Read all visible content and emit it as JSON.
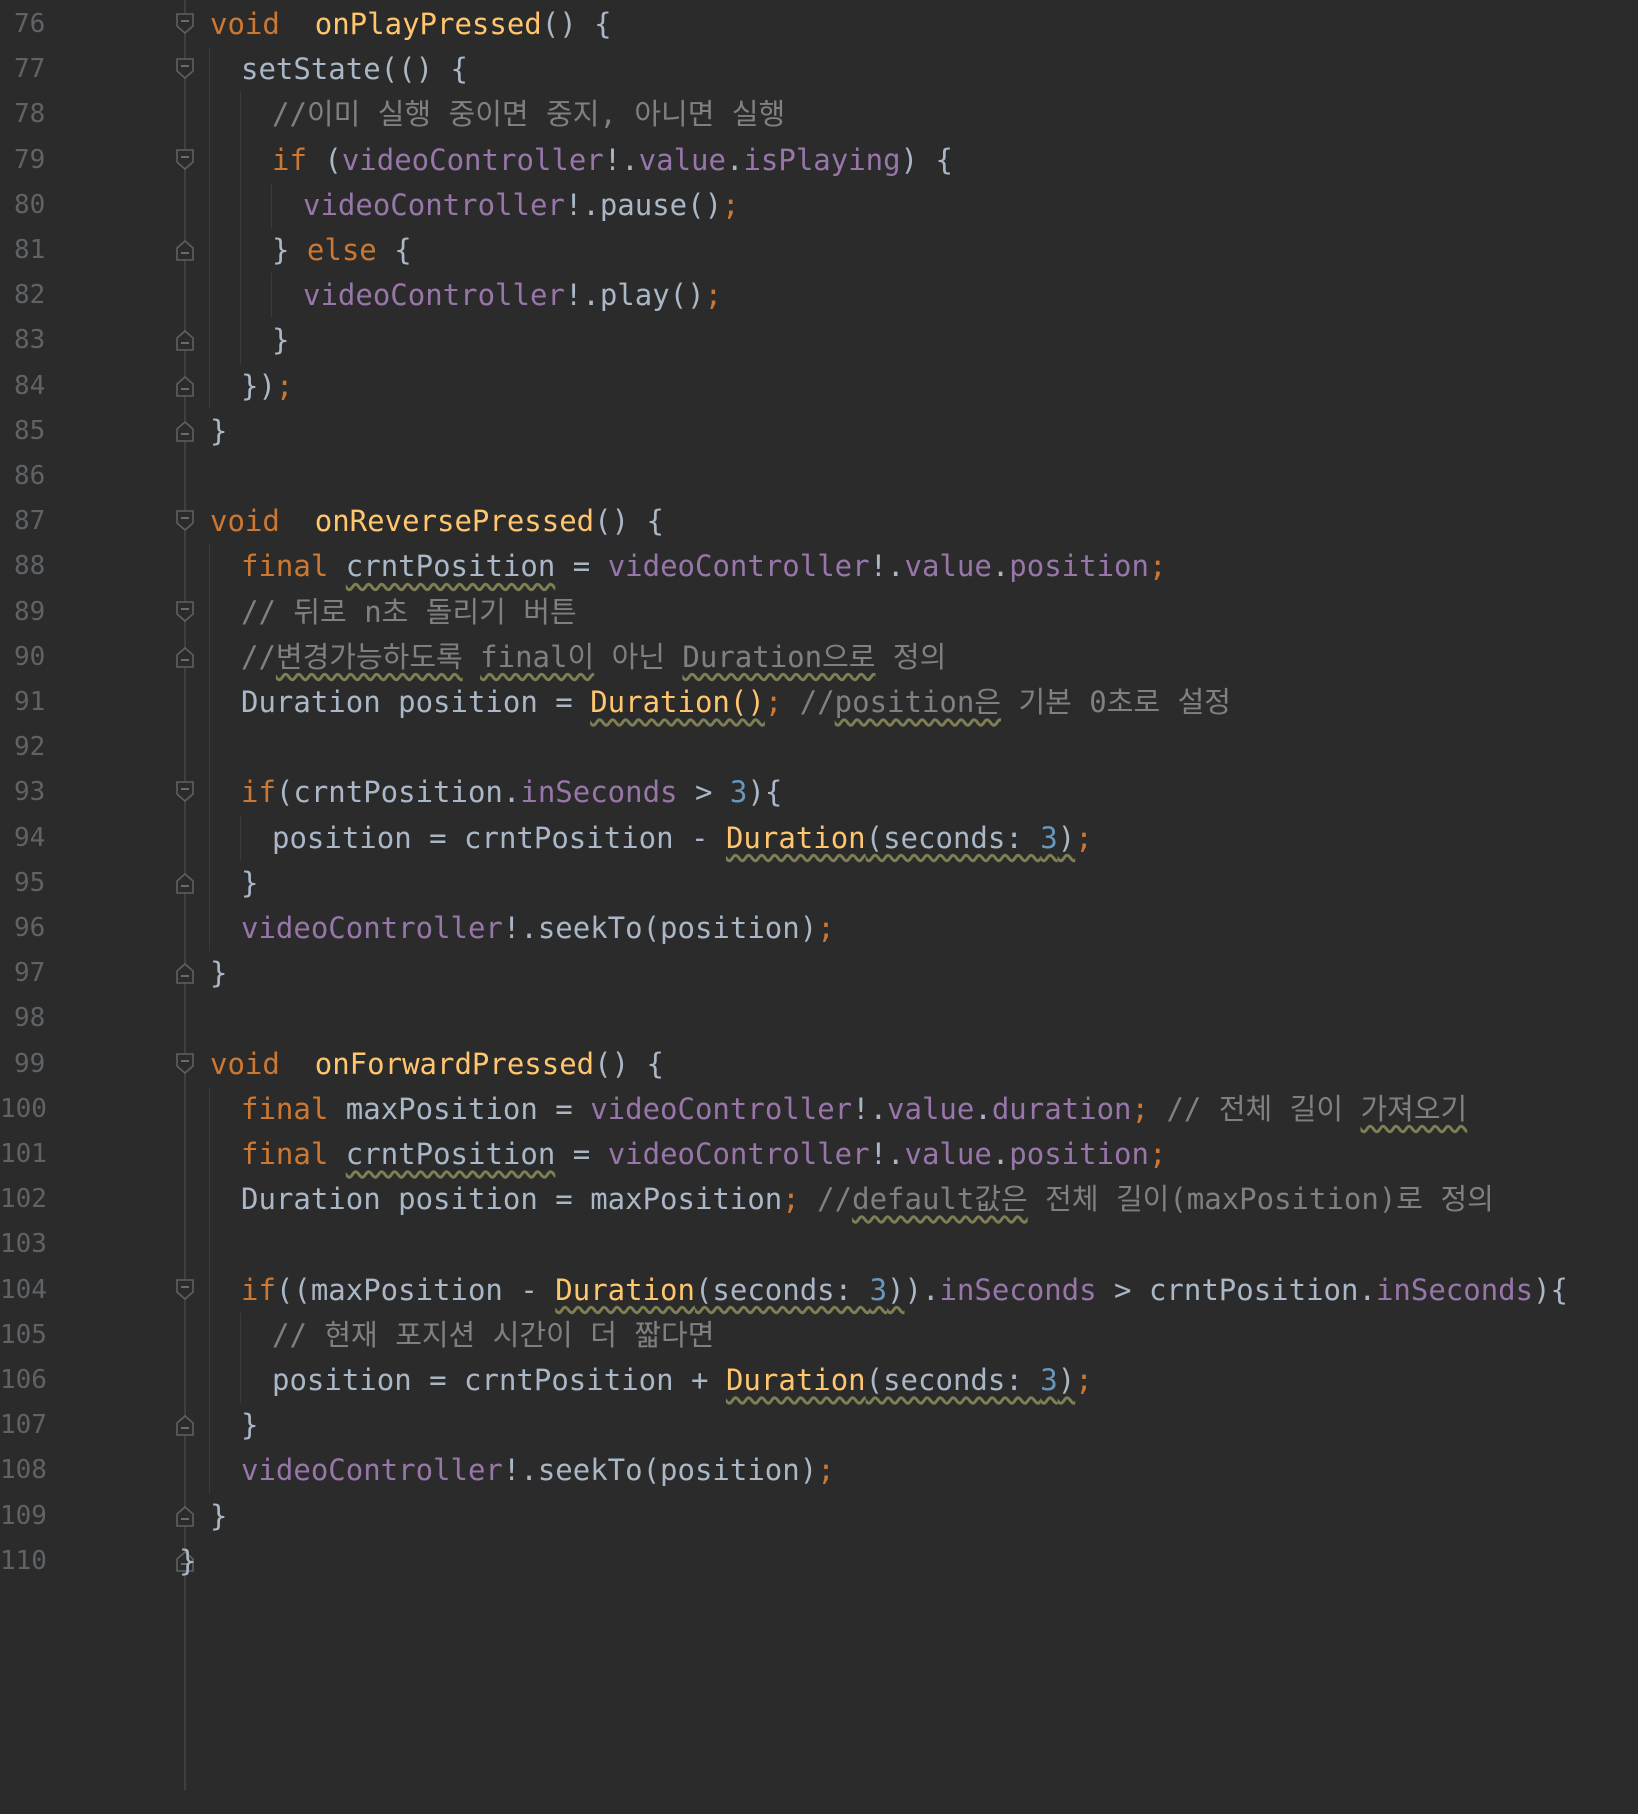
{
  "editor": {
    "colors": {
      "background": "#2b2b2b",
      "keyword": "#cc7832",
      "function": "#ffc66d",
      "field": "#9876aa",
      "number": "#6897bb",
      "comment": "#808080",
      "default": "#a9b7c6",
      "line_number": "#606366"
    },
    "fold_icons": [
      "fold-open-icon",
      "fold-close-icon"
    ],
    "lines": [
      {
        "n": "76",
        "indent": 1,
        "fold": "open",
        "tokens": [
          [
            "kw",
            "void"
          ],
          [
            "",
            "  "
          ],
          [
            "fn",
            "onPlayPressed"
          ],
          [
            "",
            "() {"
          ]
        ]
      },
      {
        "n": "77",
        "indent": 2,
        "fold": "open",
        "tokens": [
          [
            "",
            "setState(() {"
          ]
        ]
      },
      {
        "n": "78",
        "indent": 3,
        "fold": "",
        "tokens": [
          [
            "cmt",
            "//이미 실행 중이면 중지, 아니면 실행"
          ]
        ]
      },
      {
        "n": "79",
        "indent": 3,
        "fold": "open",
        "tokens": [
          [
            "kw",
            "if"
          ],
          [
            "",
            " ("
          ],
          [
            "fld",
            "videoController"
          ],
          [
            "",
            "!."
          ],
          [
            "fld",
            "value"
          ],
          [
            "",
            "."
          ],
          [
            "fld",
            "isPlaying"
          ],
          [
            "",
            ") {"
          ]
        ]
      },
      {
        "n": "80",
        "indent": 4,
        "fold": "",
        "tokens": [
          [
            "fld",
            "videoController"
          ],
          [
            "",
            "!.pause()"
          ],
          [
            "kw",
            ";"
          ]
        ]
      },
      {
        "n": "81",
        "indent": 3,
        "fold": "close",
        "tokens": [
          [
            "",
            "} "
          ],
          [
            "kw",
            "else"
          ],
          [
            "",
            " {"
          ]
        ]
      },
      {
        "n": "82",
        "indent": 4,
        "fold": "",
        "tokens": [
          [
            "fld",
            "videoController"
          ],
          [
            "",
            "!.play()"
          ],
          [
            "kw",
            ";"
          ]
        ]
      },
      {
        "n": "83",
        "indent": 3,
        "fold": "close",
        "tokens": [
          [
            "",
            "}"
          ]
        ]
      },
      {
        "n": "84",
        "indent": 2,
        "fold": "close",
        "tokens": [
          [
            "",
            "})"
          ],
          [
            "kw",
            ";"
          ]
        ]
      },
      {
        "n": "85",
        "indent": 1,
        "fold": "close",
        "tokens": [
          [
            "",
            "}"
          ]
        ]
      },
      {
        "n": "86",
        "indent": 1,
        "fold": "",
        "tokens": []
      },
      {
        "n": "87",
        "indent": 1,
        "fold": "open",
        "tokens": [
          [
            "kw",
            "void"
          ],
          [
            "",
            "  "
          ],
          [
            "fn",
            "onReversePressed"
          ],
          [
            "",
            "() {"
          ]
        ]
      },
      {
        "n": "88",
        "indent": 2,
        "fold": "",
        "tokens": [
          [
            "kw",
            "final"
          ],
          [
            "",
            " "
          ],
          [
            "warn",
            "crntPosition"
          ],
          [
            "",
            " = "
          ],
          [
            "fld",
            "videoController"
          ],
          [
            "",
            "!."
          ],
          [
            "fld",
            "value"
          ],
          [
            "",
            "."
          ],
          [
            "fld",
            "position"
          ],
          [
            "kw",
            ";"
          ]
        ]
      },
      {
        "n": "89",
        "indent": 2,
        "fold": "open",
        "tokens": [
          [
            "cmt",
            "// 뒤로 n초 돌리기 버튼"
          ]
        ]
      },
      {
        "n": "90",
        "indent": 2,
        "fold": "close",
        "tokens": [
          [
            "cmt",
            "//"
          ],
          [
            "cmtw",
            "변경가능하도록"
          ],
          [
            "cmt",
            " "
          ],
          [
            "cmtw",
            "final이"
          ],
          [
            "cmt",
            " 아닌 "
          ],
          [
            "cmtw",
            "Duration으로"
          ],
          [
            "cmt",
            " 정의"
          ]
        ]
      },
      {
        "n": "91",
        "indent": 2,
        "fold": "",
        "tokens": [
          [
            "",
            "Duration position = "
          ],
          [
            "fnw",
            "Duration()"
          ],
          [
            "kw",
            ";"
          ],
          [
            "cmt",
            " //"
          ],
          [
            "cmtw",
            "position은"
          ],
          [
            "cmt",
            " 기본 0초로 설정"
          ]
        ]
      },
      {
        "n": "92",
        "indent": 2,
        "fold": "",
        "tokens": []
      },
      {
        "n": "93",
        "indent": 2,
        "fold": "open",
        "tokens": [
          [
            "kw",
            "if"
          ],
          [
            "",
            "(crntPosition."
          ],
          [
            "fld",
            "inSeconds"
          ],
          [
            "",
            " > "
          ],
          [
            "num",
            "3"
          ],
          [
            "",
            "){"
          ]
        ]
      },
      {
        "n": "94",
        "indent": 3,
        "fold": "",
        "tokens": [
          [
            "",
            "position = crntPosition - "
          ],
          [
            "fnw",
            "Duration"
          ],
          [
            "warn",
            "(seconds: "
          ],
          [
            "numw",
            "3"
          ],
          [
            "warn",
            ")"
          ],
          [
            "kw",
            ";"
          ]
        ]
      },
      {
        "n": "95",
        "indent": 2,
        "fold": "close",
        "tokens": [
          [
            "",
            "}"
          ]
        ]
      },
      {
        "n": "96",
        "indent": 2,
        "fold": "",
        "tokens": [
          [
            "fld",
            "videoController"
          ],
          [
            "",
            "!.seekTo(position)"
          ],
          [
            "kw",
            ";"
          ]
        ]
      },
      {
        "n": "97",
        "indent": 1,
        "fold": "close",
        "tokens": [
          [
            "",
            "}"
          ]
        ]
      },
      {
        "n": "98",
        "indent": 1,
        "fold": "",
        "tokens": []
      },
      {
        "n": "99",
        "indent": 1,
        "fold": "open",
        "tokens": [
          [
            "kw",
            "void"
          ],
          [
            "",
            "  "
          ],
          [
            "fn",
            "onForwardPressed"
          ],
          [
            "",
            "() {"
          ]
        ]
      },
      {
        "n": "100",
        "indent": 2,
        "fold": "",
        "tokens": [
          [
            "kw",
            "final"
          ],
          [
            "",
            " maxPosition = "
          ],
          [
            "fld",
            "videoController"
          ],
          [
            "",
            "!."
          ],
          [
            "fld",
            "value"
          ],
          [
            "",
            "."
          ],
          [
            "fld",
            "duration"
          ],
          [
            "kw",
            ";"
          ],
          [
            "cmt",
            " // 전체 길이 "
          ],
          [
            "cmtw",
            "가져오기"
          ]
        ]
      },
      {
        "n": "101",
        "indent": 2,
        "fold": "",
        "tokens": [
          [
            "kw",
            "final"
          ],
          [
            "",
            " "
          ],
          [
            "warn",
            "crntPosition"
          ],
          [
            "",
            " = "
          ],
          [
            "fld",
            "videoController"
          ],
          [
            "",
            "!."
          ],
          [
            "fld",
            "value"
          ],
          [
            "",
            "."
          ],
          [
            "fld",
            "position"
          ],
          [
            "kw",
            ";"
          ]
        ]
      },
      {
        "n": "102",
        "indent": 2,
        "fold": "",
        "tokens": [
          [
            "",
            "Duration position = maxPosition"
          ],
          [
            "kw",
            ";"
          ],
          [
            "cmt",
            " //"
          ],
          [
            "cmtw",
            "default값은"
          ],
          [
            "cmt",
            " 전체 길이(maxPosition)로 정의"
          ]
        ]
      },
      {
        "n": "103",
        "indent": 2,
        "fold": "",
        "tokens": []
      },
      {
        "n": "104",
        "indent": 2,
        "fold": "open",
        "tokens": [
          [
            "kw",
            "if"
          ],
          [
            "",
            "((maxPosition - "
          ],
          [
            "fnw",
            "Duration"
          ],
          [
            "warn",
            "(seconds: "
          ],
          [
            "numw",
            "3"
          ],
          [
            "warn",
            ")"
          ],
          [
            "",
            ")."
          ],
          [
            "fld",
            "inSeconds"
          ],
          [
            "",
            " > crntPosition."
          ],
          [
            "fld",
            "inSeconds"
          ],
          [
            "",
            "){"
          ]
        ]
      },
      {
        "n": "105",
        "indent": 3,
        "fold": "",
        "tokens": [
          [
            "cmt",
            "// 현재 포지션 시간이 더 짧다면"
          ]
        ]
      },
      {
        "n": "106",
        "indent": 3,
        "fold": "",
        "tokens": [
          [
            "",
            "position = crntPosition + "
          ],
          [
            "fnw",
            "Duration"
          ],
          [
            "warn",
            "(seconds: "
          ],
          [
            "numw",
            "3"
          ],
          [
            "warn",
            ")"
          ],
          [
            "kw",
            ";"
          ]
        ]
      },
      {
        "n": "107",
        "indent": 2,
        "fold": "close",
        "tokens": [
          [
            "",
            "}"
          ]
        ]
      },
      {
        "n": "108",
        "indent": 2,
        "fold": "",
        "tokens": [
          [
            "fld",
            "videoController"
          ],
          [
            "",
            "!.seekTo(position)"
          ],
          [
            "kw",
            ";"
          ]
        ]
      },
      {
        "n": "109",
        "indent": 1,
        "fold": "close",
        "tokens": [
          [
            "",
            "}"
          ]
        ]
      },
      {
        "n": "110",
        "indent": 0,
        "fold": "close",
        "tokens": [
          [
            "",
            "}"
          ]
        ]
      }
    ]
  }
}
